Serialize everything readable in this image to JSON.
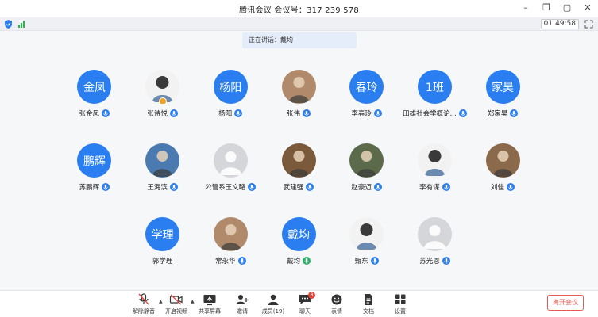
{
  "titlebar": {
    "title": "腾讯会议 会议号：317 239 578"
  },
  "window_controls": {
    "minimize": "–",
    "restore": "❐",
    "maximize": "▢",
    "close": "✕"
  },
  "statusbar": {
    "timer": "01:49:58"
  },
  "speaking": {
    "text": "正在讲话：戴均"
  },
  "participants": [
    [
      {
        "name": "张金凤",
        "initials": "金凤",
        "type": "initials",
        "mic": "blue"
      },
      {
        "name": "张诗悦",
        "initials": "",
        "type": "white",
        "mic": "blue",
        "host": true
      },
      {
        "name": "杨阳",
        "initials": "杨阳",
        "type": "initials",
        "mic": "blue"
      },
      {
        "name": "张伟",
        "initials": "",
        "type": "photo",
        "mic": "blue"
      },
      {
        "name": "李春玲",
        "initials": "春玲",
        "type": "initials",
        "mic": "blue"
      },
      {
        "name": "田雄社会学概论...",
        "initials": "1班",
        "type": "initials",
        "mic": "blue"
      },
      {
        "name": "郑家昊",
        "initials": "家昊",
        "type": "initials",
        "mic": "blue"
      }
    ],
    [
      {
        "name": "苏鹏辉",
        "initials": "鹏辉",
        "type": "initials",
        "mic": "blue"
      },
      {
        "name": "王海滨",
        "initials": "",
        "type": "photo",
        "mic": "blue"
      },
      {
        "name": "公管系王文略",
        "initials": "",
        "type": "gray",
        "mic": "blue"
      },
      {
        "name": "武建强",
        "initials": "",
        "type": "photo",
        "mic": "blue"
      },
      {
        "name": "赵豪迈",
        "initials": "",
        "type": "photo",
        "mic": "blue"
      },
      {
        "name": "李有谋",
        "initials": "",
        "type": "white",
        "mic": "blue"
      },
      {
        "name": "刘佳",
        "initials": "",
        "type": "photo",
        "mic": "blue"
      }
    ],
    [
      {
        "name": "郭学理",
        "initials": "学理",
        "type": "initials",
        "mic": "none"
      },
      {
        "name": "常永华",
        "initials": "",
        "type": "photo",
        "mic": "blue"
      },
      {
        "name": "戴均",
        "initials": "戴均",
        "type": "initials",
        "mic": "green"
      },
      {
        "name": "甄东",
        "initials": "",
        "type": "white",
        "mic": "blue"
      },
      {
        "name": "苏光恩",
        "initials": "",
        "type": "gray",
        "mic": "blue"
      }
    ]
  ],
  "toolbar": {
    "mute": "解除静音",
    "video": "开启视频",
    "share": "共享屏幕",
    "invite": "邀请",
    "members": "成员(19)",
    "chat": "聊天",
    "chat_badge": "8",
    "emoji": "表情",
    "docs": "文档",
    "settings": "设置",
    "leave": "离开会议"
  },
  "colors": {
    "accent": "#2a7ef0",
    "speaking_mic": "#29b36a",
    "leave": "#e65a4f"
  }
}
